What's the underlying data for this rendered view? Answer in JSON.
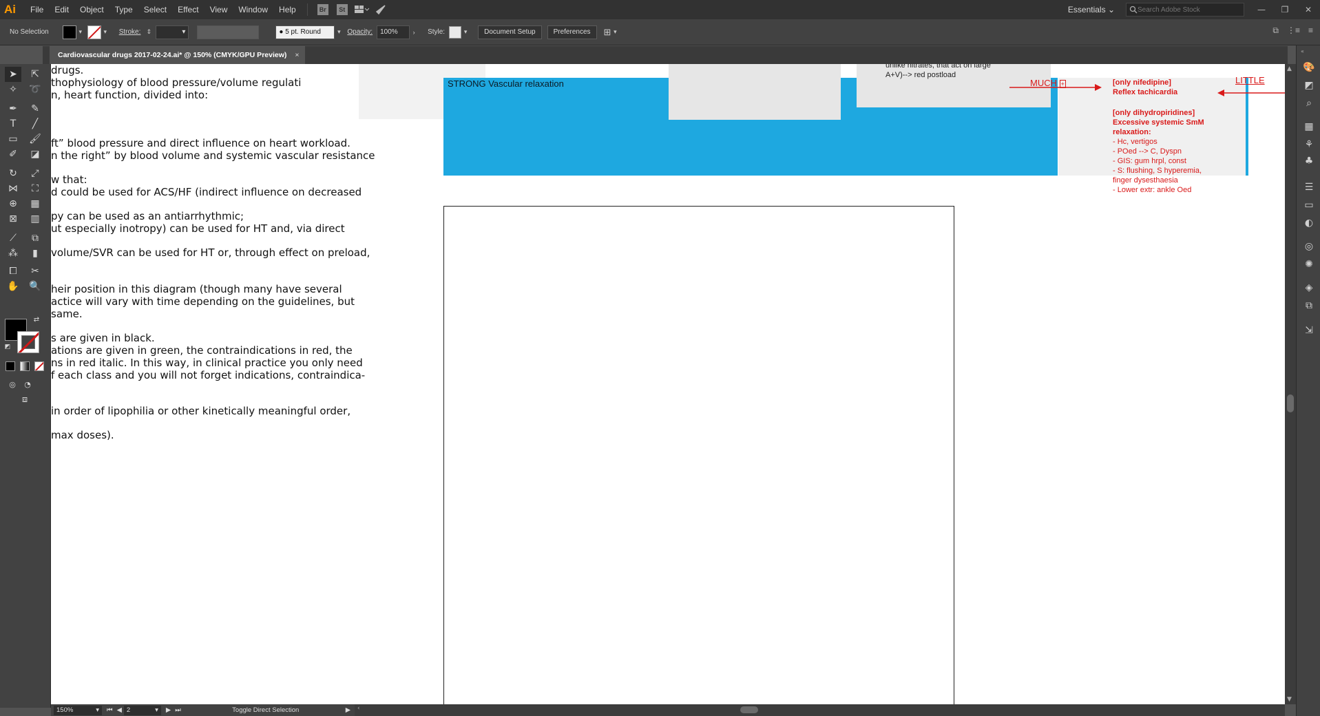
{
  "app": {
    "logo": "Ai",
    "menu": [
      "File",
      "Edit",
      "Object",
      "Type",
      "Select",
      "Effect",
      "View",
      "Window",
      "Help"
    ],
    "bridge_label": "Br",
    "stock_label": "St",
    "workspace": "Essentials",
    "search_placeholder": "Search Adobe Stock"
  },
  "controlbar": {
    "selection": "No Selection",
    "stroke_label": "Stroke:",
    "brush": "5 pt. Round",
    "opacity_label": "Opacity:",
    "opacity_value": "100%",
    "style_label": "Style:",
    "document_setup": "Document Setup",
    "preferences": "Preferences"
  },
  "tab": {
    "title": "Cardiovascular drugs 2017-02-24.ai* @ 150% (CMYK/GPU Preview)",
    "close": "×"
  },
  "document": {
    "lines": [
      "drugs.",
      "thophysiology of blood pressure/volume regulati",
      "n, heart function, divided into:",
      "ft” blood pressure and direct influence on heart workload.",
      "n the right” by blood volume and systemic vascular resistance",
      "w that:",
      "d could be used for ACS/HF (indirect influence on decreased",
      "py can be used as an antiarrhythmic;",
      "ut especially inotropy) can be used for HT and, via direct",
      "volume/SVR can be used for HT or, through effect on preload,",
      "heir position in this diagram (though many have several",
      "actice will vary with time depending on the guidelines, but",
      "same.",
      "s are given in black.",
      "ations are given in green, the contraindications in red, the",
      "ns in red italic. In this way, in clinical practice you only need",
      "f each class and you will not forget indications, contraindica-",
      "in order of lipophilia or other kinetically meaningful order,",
      "max doses)."
    ],
    "strong_label": "STRONG Vascular relaxation",
    "nitrates_note": [
      "unlike nitrates, that act on large",
      "A+V)--> red postload"
    ],
    "much": "MUCH",
    "little": "LITTLE",
    "red_block_1": [
      "[only nifedipine]",
      "Reflex tachicardia"
    ],
    "red_block_2": [
      "[only dihydropiridines]",
      "Excessive systemic SmM",
      "relaxation:"
    ],
    "red_list": [
      "- Hc, vertigos",
      "- POed --> C, Dyspn",
      "- GIS: gum hrpl, const",
      "- S: flushing, S hyperemia,",
      "finger dysesthaesia",
      "- Lower extr: ankle Oed"
    ]
  },
  "status": {
    "zoom": "150%",
    "page": "2",
    "tool_hint": "Toggle Direct Selection"
  },
  "colors": {
    "accent_blue": "#1ea8e0",
    "annotation_red": "#d91a1a",
    "ui_dark": "#323232"
  }
}
